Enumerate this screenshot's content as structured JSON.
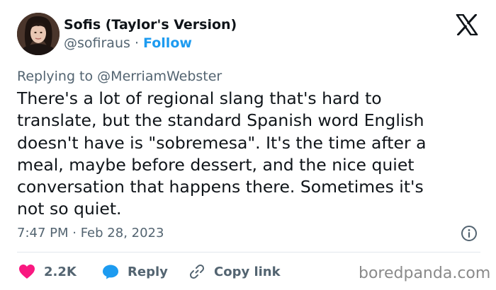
{
  "author": {
    "display_name": "Sofis (Taylor's Version)",
    "handle": "@sofiraus",
    "separator": "·",
    "follow_label": "Follow"
  },
  "reply_context": {
    "prefix": "Replying to",
    "mention": "@MerriamWebster"
  },
  "tweet_lines": [
    "There's a lot of regional slang that's hard to",
    "translate, but the standard Spanish word English",
    "doesn't have is \"sobremesa\". It's the time after a",
    "meal, maybe before dessert, and the nice quiet",
    "conversation that happens there. Sometimes it's",
    "not so quiet."
  ],
  "timestamp": "7:47 PM · Feb 28, 2023",
  "actions": {
    "like_count": "2.2K",
    "reply_label": "Reply",
    "copy_label": "Copy link"
  },
  "watermark": "boredpanda.com",
  "colors": {
    "text_primary": "#0f1419",
    "text_secondary": "#536471",
    "link_blue": "#1d9bf0",
    "like_pink": "#f91880",
    "divider": "#e1e8ed"
  },
  "icons": {
    "platform": "x-logo-icon",
    "info": "info-icon",
    "like": "heart-icon",
    "reply": "speech-bubble-icon",
    "copy": "link-icon"
  }
}
